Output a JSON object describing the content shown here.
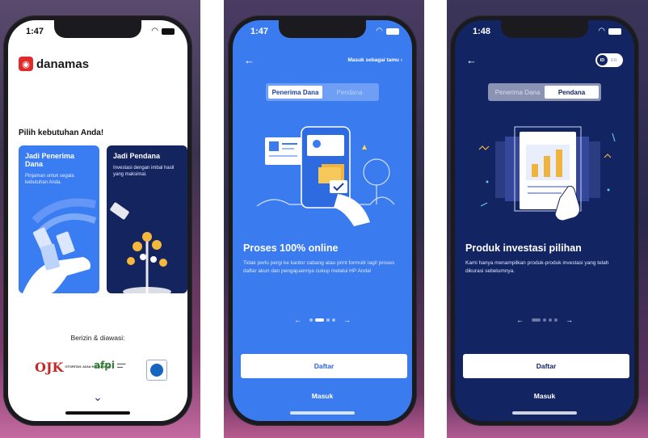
{
  "colors": {
    "brand_blue": "#3b7bf0",
    "navy": "#132463",
    "danamas_red": "#e02b2b"
  },
  "phone1": {
    "time": "1:47",
    "brand": "danamas",
    "heading": "Pilih kebutuhan Anda!",
    "card_borrower": {
      "title": "Jadi Penerima Dana",
      "desc": "Pinjaman untuk segala kebutuhan Anda."
    },
    "card_lender": {
      "title": "Jadi Pendana",
      "desc": "Investasi dengan imbal hasil yang maksimal."
    },
    "regulated_label": "Berizin & diawasi:",
    "logos": {
      "ojk_mark": "OJK",
      "ojk_text": "OTORITAS JASA KEUANGAN",
      "afpi_mark": "afpi"
    }
  },
  "phone2": {
    "time": "1:47",
    "guest_link": "Masuk sebagai tamu",
    "tabs": [
      "Penerima Dana",
      "Pendana"
    ],
    "headline": "Proses 100% online",
    "description": "Tidak perlu pergi ke kantor cabang atau print formulir lagi! proses daftar akun dan pengajuannya cukup melalui HP Anda!",
    "register_button": "Daftar",
    "login_button": "Masuk"
  },
  "phone3": {
    "time": "1:48",
    "lang_active": "ID",
    "lang_inactive": "EN",
    "tabs": [
      "Penerima Dana",
      "Pendana"
    ],
    "headline": "Produk investasi pilihan",
    "description": "Kami hanya menampilkan produk-produk investasi yang telah dikurasi sebelumnya.",
    "register_button": "Daftar",
    "login_button": "Masuk"
  }
}
